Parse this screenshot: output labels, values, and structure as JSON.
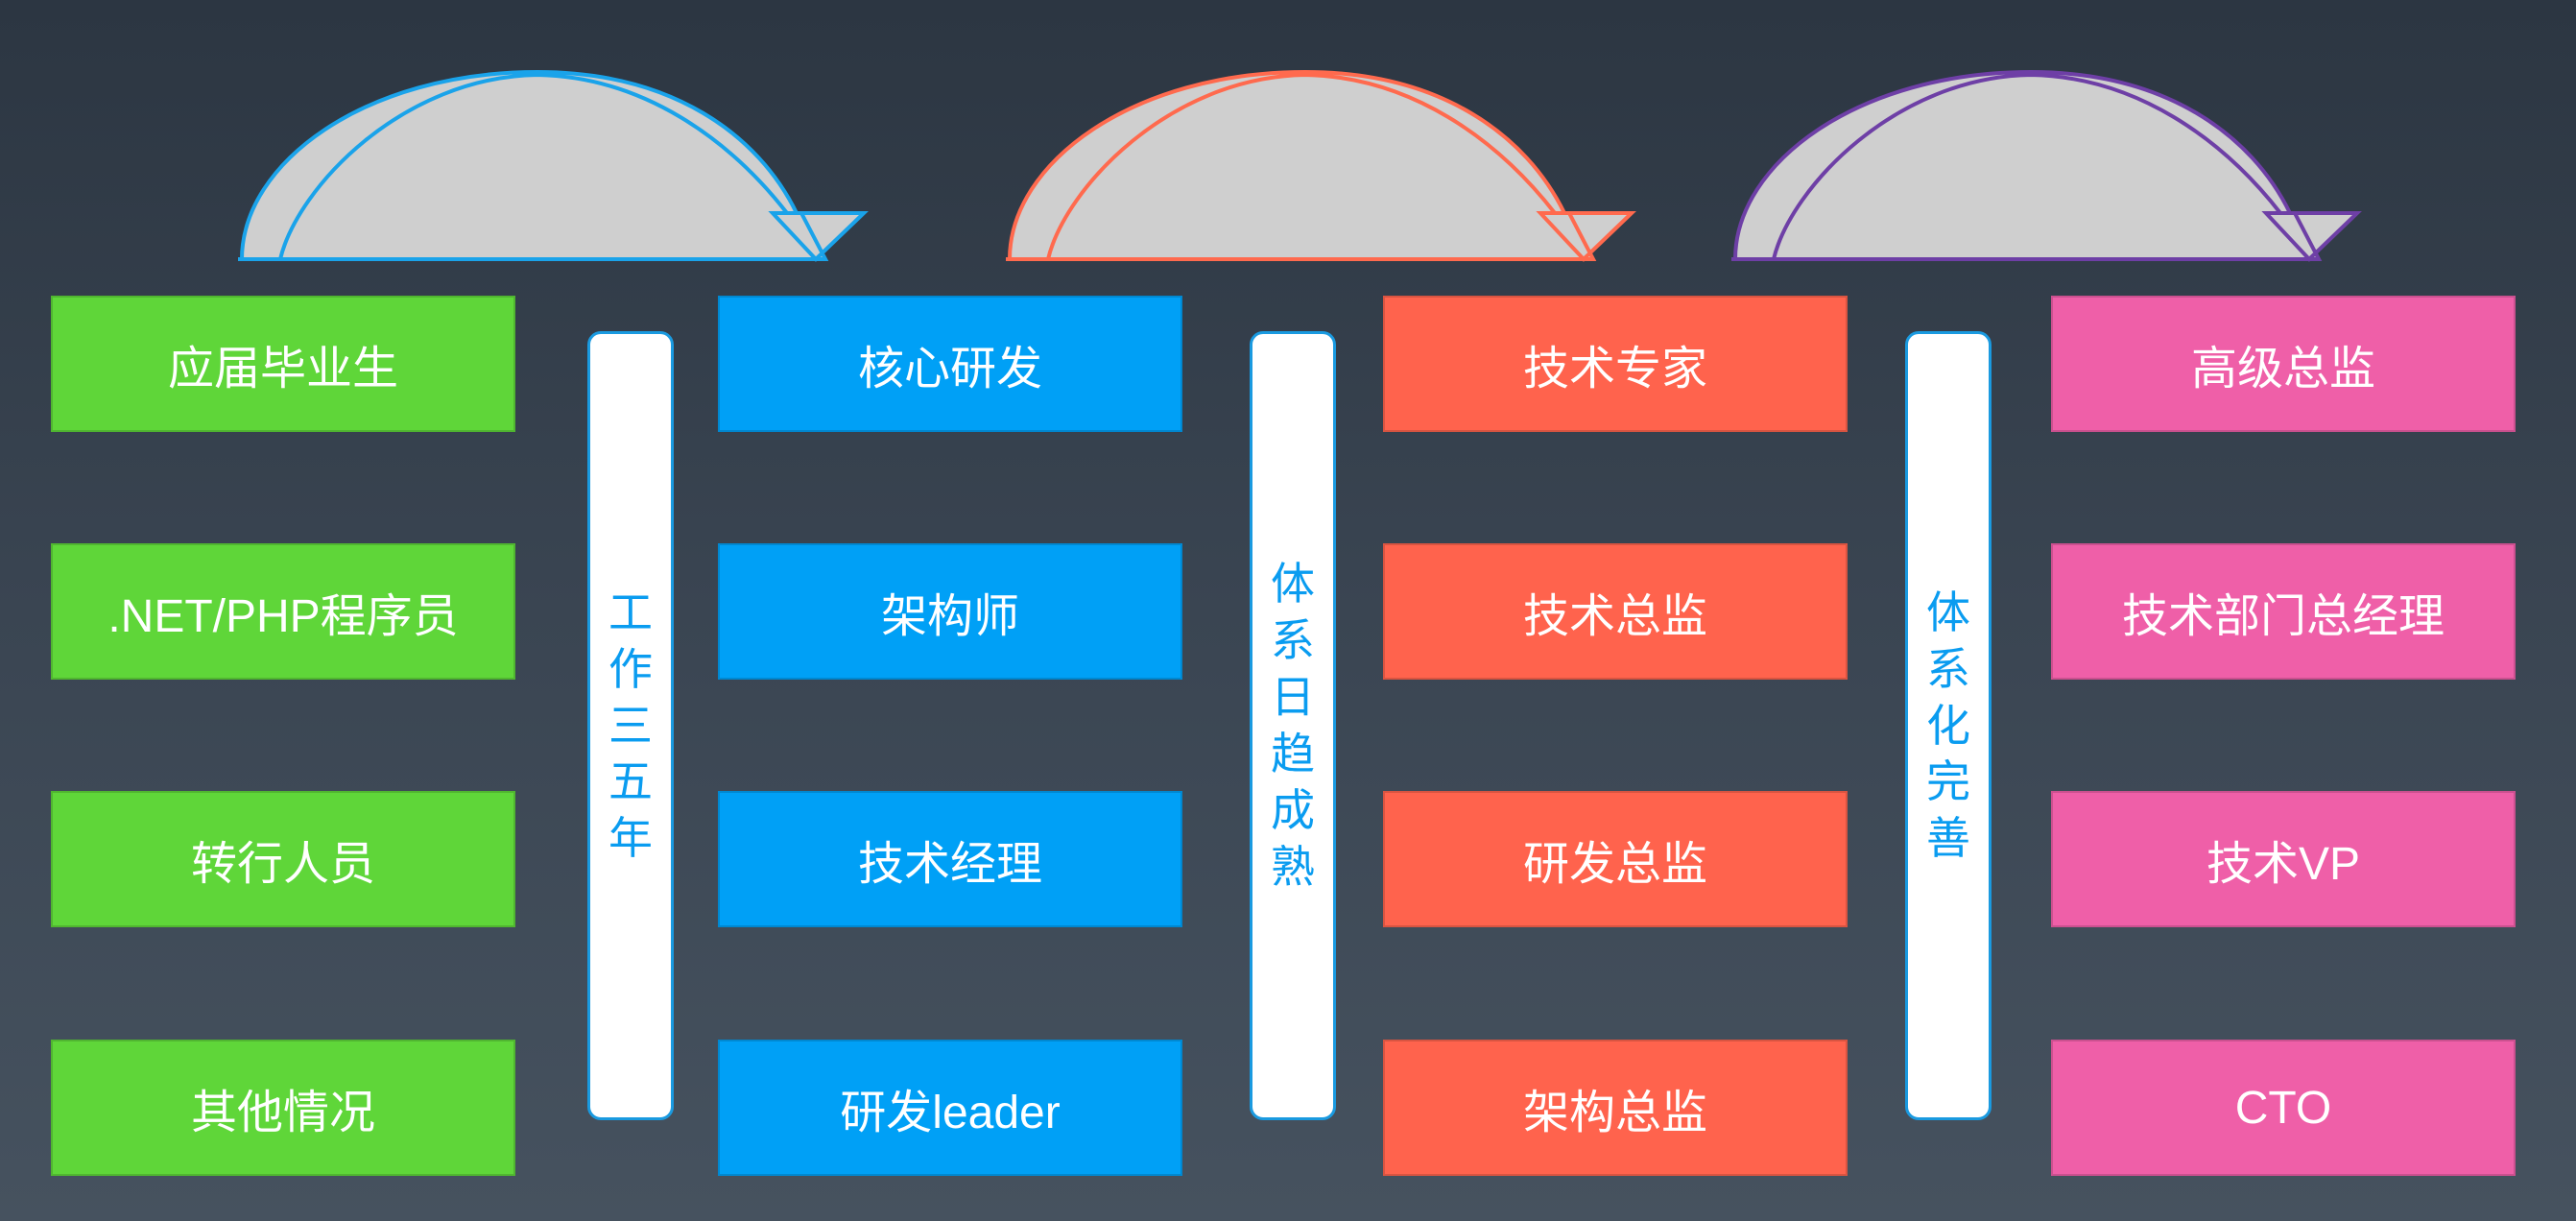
{
  "colors": {
    "green": "#5fd639",
    "blue": "#00a0f6",
    "orange": "#ff634d",
    "pink": "#ef5fa8",
    "pillar_text": "#0a9cf0",
    "arrow_fill": "#cfcfcf"
  },
  "columns": [
    {
      "id": "entry",
      "color": "#5fd639",
      "items": [
        "应届毕业生",
        ".NET/PHP程序员",
        "转行人员",
        "其他情况"
      ]
    },
    {
      "id": "core",
      "color": "#00a0f6",
      "items": [
        "核心研发",
        "架构师",
        "技术经理",
        "研发leader"
      ]
    },
    {
      "id": "expert",
      "color": "#ff634d",
      "items": [
        "技术专家",
        "技术总监",
        "研发总监",
        "架构总监"
      ]
    },
    {
      "id": "executive",
      "color": "#ef5fa8",
      "items": [
        "高级总监",
        "技术部门总经理",
        "技术VP",
        "CTO"
      ]
    }
  ],
  "pillars": [
    {
      "id": "stage-1",
      "text": "工作三五年"
    },
    {
      "id": "stage-2",
      "text": "体系日趋成熟"
    },
    {
      "id": "stage-3",
      "text": "体系化完善"
    }
  ],
  "arrows": [
    {
      "id": "arrow-1",
      "outline": "#1aa3ea"
    },
    {
      "id": "arrow-2",
      "outline": "#ff6a4e"
    },
    {
      "id": "arrow-3",
      "outline": "#6e3fa6"
    }
  ]
}
